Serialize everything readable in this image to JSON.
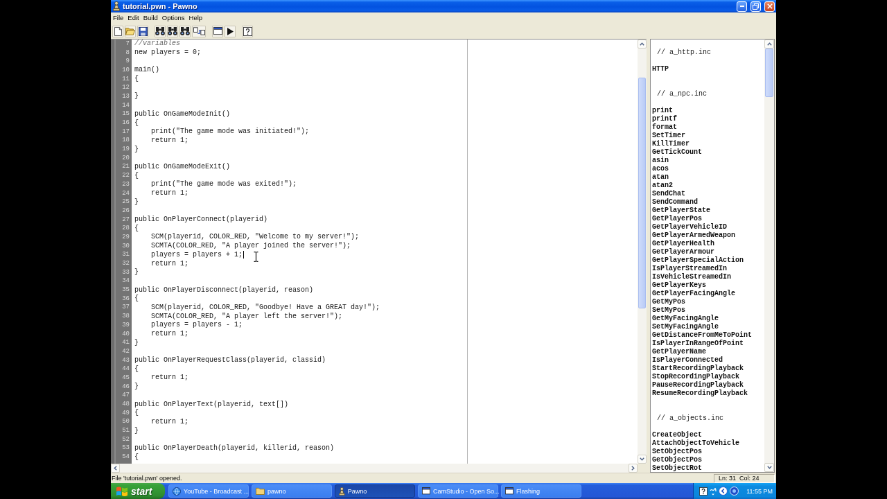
{
  "window": {
    "title": "tutorial.pwn - Pawno"
  },
  "menu": [
    "File",
    "Edit",
    "Build",
    "Options",
    "Help"
  ],
  "editor": {
    "lines": [
      {
        "number": "7",
        "kind": "comment",
        "text": "//variables",
        "caret": false
      },
      {
        "number": "8",
        "kind": "code",
        "text": "new players = 0;",
        "caret": false
      },
      {
        "number": "9",
        "kind": "blank",
        "caret": false
      },
      {
        "number": "10",
        "kind": "code",
        "text": "main()",
        "caret": false
      },
      {
        "number": "11",
        "kind": "code",
        "text": "{",
        "caret": false
      },
      {
        "number": "12",
        "kind": "blank",
        "caret": false
      },
      {
        "number": "13",
        "kind": "code",
        "text": "}",
        "caret": false
      },
      {
        "number": "14",
        "kind": "blank",
        "caret": false
      },
      {
        "number": "15",
        "kind": "code",
        "text": "public OnGameModeInit()",
        "caret": false
      },
      {
        "number": "16",
        "kind": "code",
        "text": "{",
        "caret": false
      },
      {
        "number": "17",
        "kind": "code",
        "text": "    print(\"The game mode was initiated!\");",
        "caret": false
      },
      {
        "number": "18",
        "kind": "code",
        "text": "    return 1;",
        "caret": false
      },
      {
        "number": "19",
        "kind": "code",
        "text": "}",
        "caret": false
      },
      {
        "number": "20",
        "kind": "blank",
        "caret": false
      },
      {
        "number": "21",
        "kind": "code",
        "text": "public OnGameModeExit()",
        "caret": false
      },
      {
        "number": "22",
        "kind": "code",
        "text": "{",
        "caret": false
      },
      {
        "number": "23",
        "kind": "code",
        "text": "    print(\"The game mode was exited!\");",
        "caret": false
      },
      {
        "number": "24",
        "kind": "code",
        "text": "    return 1;",
        "caret": false
      },
      {
        "number": "25",
        "kind": "code",
        "text": "}",
        "caret": false
      },
      {
        "number": "26",
        "kind": "blank",
        "caret": false
      },
      {
        "number": "27",
        "kind": "code",
        "text": "public OnPlayerConnect(playerid)",
        "caret": false
      },
      {
        "number": "28",
        "kind": "code",
        "text": "{",
        "caret": false
      },
      {
        "number": "29",
        "kind": "code",
        "text": "    SCM(playerid, COLOR_RED, \"Welcome to my server!\");",
        "caret": false
      },
      {
        "number": "30",
        "kind": "code",
        "text": "    SCMTA(COLOR_RED, \"A player joined the server!\");",
        "caret": false
      },
      {
        "number": "31",
        "kind": "code",
        "text": "    players = players + 1;",
        "caret": true
      },
      {
        "number": "32",
        "kind": "code",
        "text": "    return 1;",
        "caret": false
      },
      {
        "number": "33",
        "kind": "code",
        "text": "}",
        "caret": false
      },
      {
        "number": "34",
        "kind": "blank",
        "caret": false
      },
      {
        "number": "35",
        "kind": "code",
        "text": "public OnPlayerDisconnect(playerid, reason)",
        "caret": false
      },
      {
        "number": "36",
        "kind": "code",
        "text": "{",
        "caret": false
      },
      {
        "number": "37",
        "kind": "code",
        "text": "    SCM(playerid, COLOR_RED, \"Goodbye! Have a GREAT day!\");",
        "caret": false
      },
      {
        "number": "38",
        "kind": "code",
        "text": "    SCMTA(COLOR_RED, \"A player left the server!\");",
        "caret": false
      },
      {
        "number": "39",
        "kind": "code",
        "text": "    players = players - 1;",
        "caret": false
      },
      {
        "number": "40",
        "kind": "code",
        "text": "    return 1;",
        "caret": false
      },
      {
        "number": "41",
        "kind": "code",
        "text": "}",
        "caret": false
      },
      {
        "number": "42",
        "kind": "blank",
        "caret": false
      },
      {
        "number": "43",
        "kind": "code",
        "text": "public OnPlayerRequestClass(playerid, classid)",
        "caret": false
      },
      {
        "number": "44",
        "kind": "code",
        "text": "{",
        "caret": false
      },
      {
        "number": "45",
        "kind": "code",
        "text": "    return 1;",
        "caret": false
      },
      {
        "number": "46",
        "kind": "code",
        "text": "}",
        "caret": false
      },
      {
        "number": "47",
        "kind": "blank",
        "caret": false
      },
      {
        "number": "48",
        "kind": "code",
        "text": "public OnPlayerText(playerid, text[])",
        "caret": false
      },
      {
        "number": "49",
        "kind": "code",
        "text": "{",
        "caret": false
      },
      {
        "number": "50",
        "kind": "code",
        "text": "    return 1;",
        "caret": false
      },
      {
        "number": "51",
        "kind": "code",
        "text": "}",
        "caret": false
      },
      {
        "number": "52",
        "kind": "blank",
        "caret": false
      },
      {
        "number": "53",
        "kind": "code",
        "text": "public OnPlayerDeath(playerid, killerid, reason)",
        "caret": false
      },
      {
        "number": "54",
        "kind": "code",
        "text": "{",
        "caret": false
      }
    ]
  },
  "function_list": {
    "sections": [
      {
        "header": "// a_http.inc",
        "items": [
          "HTTP"
        ]
      },
      {
        "header": "// a_npc.inc",
        "items": [
          "print",
          "printf",
          "format",
          "SetTimer",
          "KillTimer",
          "GetTickCount",
          "asin",
          "acos",
          "atan",
          "atan2",
          "SendChat",
          "SendCommand",
          "GetPlayerState",
          "GetPlayerPos",
          "GetPlayerVehicleID",
          "GetPlayerArmedWeapon",
          "GetPlayerHealth",
          "GetPlayerArmour",
          "GetPlayerSpecialAction",
          "IsPlayerStreamedIn",
          "IsVehicleStreamedIn",
          "GetPlayerKeys",
          "GetPlayerFacingAngle",
          "GetMyPos",
          "SetMyPos",
          "GetMyFacingAngle",
          "SetMyFacingAngle",
          "GetDistanceFromMeToPoint",
          "IsPlayerInRangeOfPoint",
          "GetPlayerName",
          "IsPlayerConnected",
          "StartRecordingPlayback",
          "StopRecordingPlayback",
          "PauseRecordingPlayback",
          "ResumeRecordingPlayback"
        ]
      },
      {
        "header": "// a_objects.inc",
        "items": [
          "CreateObject",
          "AttachObjectToVehicle",
          "SetObjectPos",
          "GetObjectPos",
          "SetObjectRot"
        ]
      }
    ]
  },
  "status_bar": {
    "message": "File 'tutorial.pwn' opened.",
    "position": "Ln: 31  Col: 24"
  },
  "taskbar": {
    "start": "start",
    "tasks": [
      {
        "label": "YouTube - Broadcast ...",
        "kind": "browser",
        "selected": false
      },
      {
        "label": "pawno",
        "kind": "folder",
        "selected": false
      },
      {
        "label": "Pawno",
        "kind": "pawn",
        "selected": true
      },
      {
        "label": "CamStudio - Open So...",
        "kind": "window",
        "selected": false
      },
      {
        "label": "Flashing",
        "kind": "window",
        "selected": false
      }
    ],
    "clock": "11:55 PM"
  }
}
